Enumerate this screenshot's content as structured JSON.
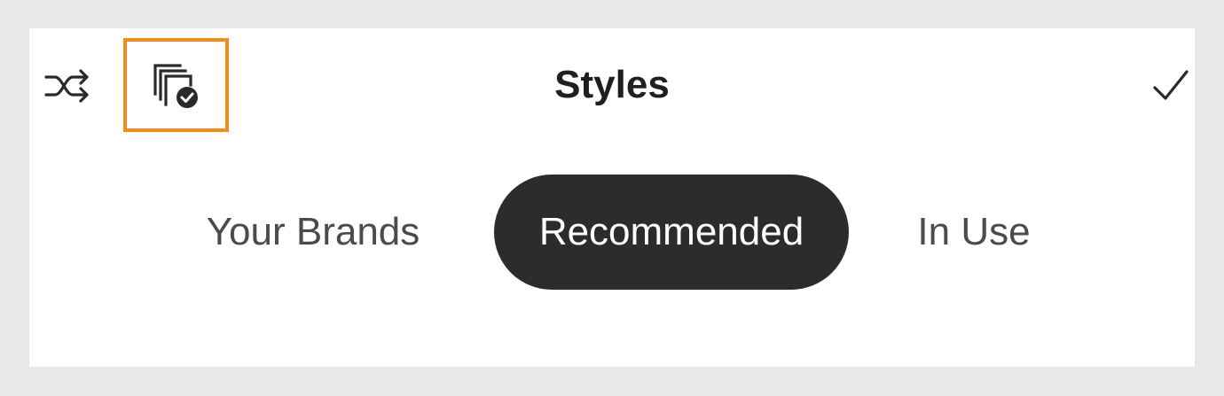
{
  "header": {
    "title": "Styles",
    "left_icons": [
      {
        "icon": "shuffle-icon"
      },
      {
        "icon": "apply-styles-icon",
        "highlighted": true
      }
    ],
    "right_icon": "checkmark-icon"
  },
  "tabs": [
    {
      "label": "Your Brands",
      "selected": false
    },
    {
      "label": "Recommended",
      "selected": true
    },
    {
      "label": "In Use",
      "selected": false
    }
  ],
  "colors": {
    "highlight": "#f28c1a",
    "selected_tab_bg": "#2c2c2c",
    "background": "#e8e8e8",
    "panel": "#ffffff"
  }
}
